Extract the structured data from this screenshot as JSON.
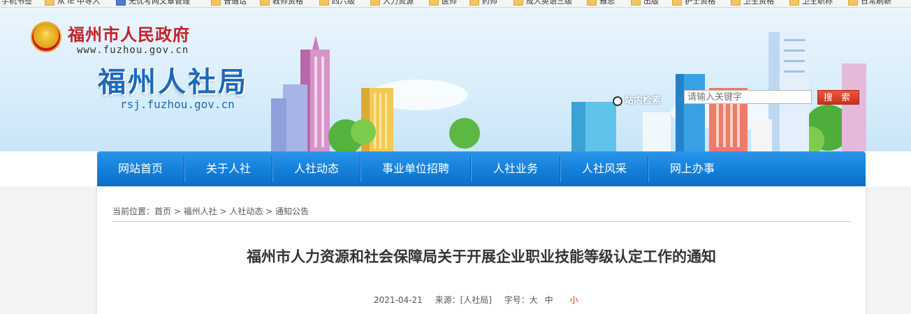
{
  "bookmarks": [
    {
      "label": "手机书签",
      "folder": false
    },
    {
      "label": "从 IE 中导入",
      "folder": true
    },
    {
      "label": "无忧考网文章管理",
      "folder": false
    },
    {
      "label": "普通话",
      "folder": true
    },
    {
      "label": "教师资格",
      "folder": true
    },
    {
      "label": "四六级",
      "folder": true
    },
    {
      "label": "人力资源",
      "folder": true
    },
    {
      "label": "医师",
      "folder": true
    },
    {
      "label": "药师",
      "folder": true
    },
    {
      "label": "成人英语三级",
      "folder": true
    },
    {
      "label": "雅思",
      "folder": true
    },
    {
      "label": "出版",
      "folder": true
    },
    {
      "label": "护士资格",
      "folder": true
    },
    {
      "label": "卫生资格",
      "folder": true
    },
    {
      "label": "卫生职称",
      "folder": true
    },
    {
      "label": "日常刷新",
      "folder": true
    }
  ],
  "header": {
    "gov_name": "福州市人民政府",
    "gov_url": "www.fuzhou.gov.cn",
    "site_name": "福州人社局",
    "site_url": "rsj.fuzhou.gov.cn",
    "search_label": "站内检索",
    "search_placeholder": "请输入关键字",
    "search_button": "搜 索"
  },
  "nav": [
    "网站首页",
    "关于人社",
    "人社动态",
    "事业单位招聘",
    "人社业务",
    "人社风采",
    "网上办事"
  ],
  "breadcrumb": "当前位置：首页 > 福州人社 > 人社动态 > 通知公告",
  "article": {
    "title": "福州市人力资源和社会保障局关于开展企业职业技能等级认定工作的通知",
    "date": "2021-04-21",
    "source": "来源：[人社局]",
    "font_size_label": "字号：",
    "size_large": "大",
    "size_medium": "中",
    "size_small": "小"
  },
  "colors": {
    "nav": "#147fd9",
    "site_name": "#1d69b8",
    "gov_name": "#c5202a",
    "search_button": "#d7401f"
  }
}
